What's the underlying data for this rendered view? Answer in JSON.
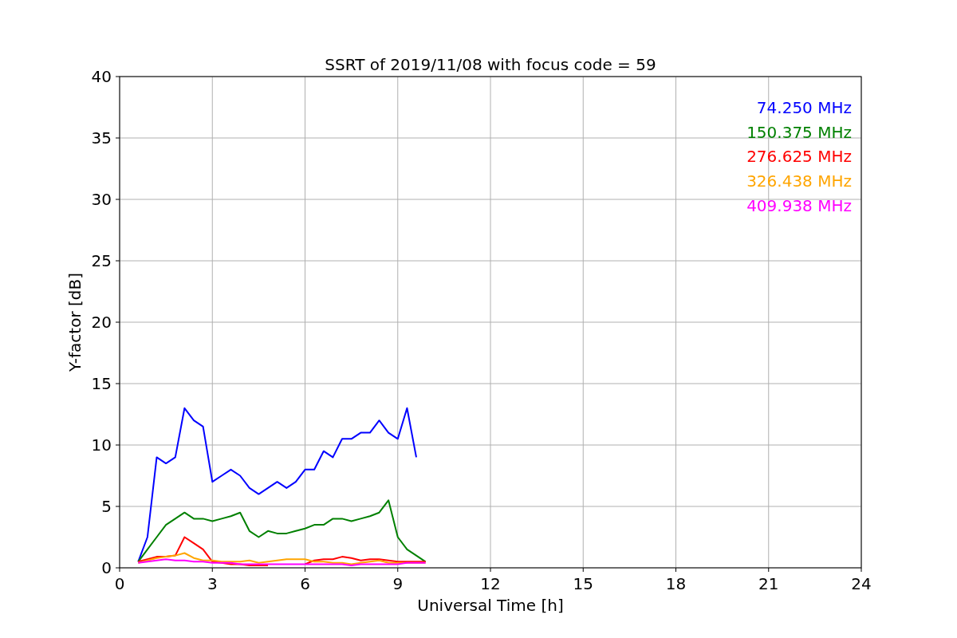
{
  "chart_data": {
    "type": "line",
    "title": "SSRT of 2019/11/08 with focus code = 59",
    "xlabel": "Universal Time [h]",
    "ylabel": "Y-factor [dB]",
    "xlim": [
      0,
      24
    ],
    "ylim": [
      0,
      40
    ],
    "xticks": [
      0,
      3,
      6,
      9,
      12,
      15,
      18,
      21,
      24
    ],
    "yticks": [
      0,
      5,
      10,
      15,
      20,
      25,
      30,
      35,
      40
    ],
    "grid": true,
    "x": [
      0.6,
      0.9,
      1.2,
      1.5,
      1.8,
      2.1,
      2.4,
      2.7,
      3.0,
      3.3,
      3.6,
      3.9,
      4.2,
      4.5,
      4.8,
      5.1,
      5.4,
      5.7,
      6.0,
      6.3,
      6.6,
      6.9,
      7.2,
      7.5,
      7.8,
      8.1,
      8.4,
      8.7,
      9.0,
      9.3,
      9.6,
      9.9
    ],
    "series": [
      {
        "name": "74.250 MHz",
        "color": "#0000ff",
        "values": [
          0.5,
          2.5,
          9,
          8.5,
          9,
          13,
          12,
          11.5,
          7,
          7.5,
          8,
          7.5,
          6.5,
          6,
          6.5,
          7,
          6.5,
          7,
          8,
          8,
          9.5,
          9,
          10.5,
          10.5,
          11,
          11,
          12,
          11,
          10.5,
          13,
          9,
          null
        ]
      },
      {
        "name": "150.375 MHz",
        "color": "#008000",
        "values": [
          0.5,
          1.5,
          2.5,
          3.5,
          4,
          4.5,
          4,
          4,
          3.8,
          4,
          4.2,
          4.5,
          3,
          2.5,
          3,
          2.8,
          2.8,
          3,
          3.2,
          3.5,
          3.5,
          4,
          4,
          3.8,
          4,
          4.2,
          4.5,
          5.5,
          2.5,
          1.5,
          1,
          0.5
        ]
      },
      {
        "name": "276.625 MHz",
        "color": "#ff0000",
        "values": [
          0.5,
          0.7,
          0.9,
          0.9,
          1,
          2.5,
          2,
          1.5,
          0.5,
          0.4,
          0.3,
          0.3,
          0.2,
          0.2,
          0.2,
          null,
          null,
          null,
          0.3,
          0.6,
          0.7,
          0.7,
          0.9,
          0.8,
          0.6,
          0.7,
          0.7,
          0.6,
          0.5,
          0.5,
          0.5,
          0.5
        ]
      },
      {
        "name": "326.438 MHz",
        "color": "#ffa500",
        "values": [
          0.4,
          0.6,
          0.8,
          0.9,
          1,
          1.2,
          0.8,
          0.6,
          0.6,
          0.5,
          0.5,
          0.5,
          0.6,
          0.4,
          0.5,
          0.6,
          0.7,
          0.7,
          0.7,
          0.5,
          0.5,
          0.4,
          0.4,
          0.3,
          0.4,
          0.5,
          0.6,
          0.4,
          0.4,
          0.4,
          0.4,
          0.4
        ]
      },
      {
        "name": "409.938 MHz",
        "color": "#ff00ff",
        "values": [
          0.4,
          0.5,
          0.6,
          0.7,
          0.6,
          0.6,
          0.5,
          0.5,
          0.4,
          0.4,
          0.4,
          0.3,
          0.3,
          0.3,
          0.3,
          0.3,
          0.3,
          0.3,
          0.3,
          0.3,
          0.3,
          0.3,
          0.3,
          0.2,
          0.3,
          0.3,
          0.3,
          0.3,
          0.3,
          0.4,
          0.4,
          0.4
        ]
      }
    ]
  }
}
